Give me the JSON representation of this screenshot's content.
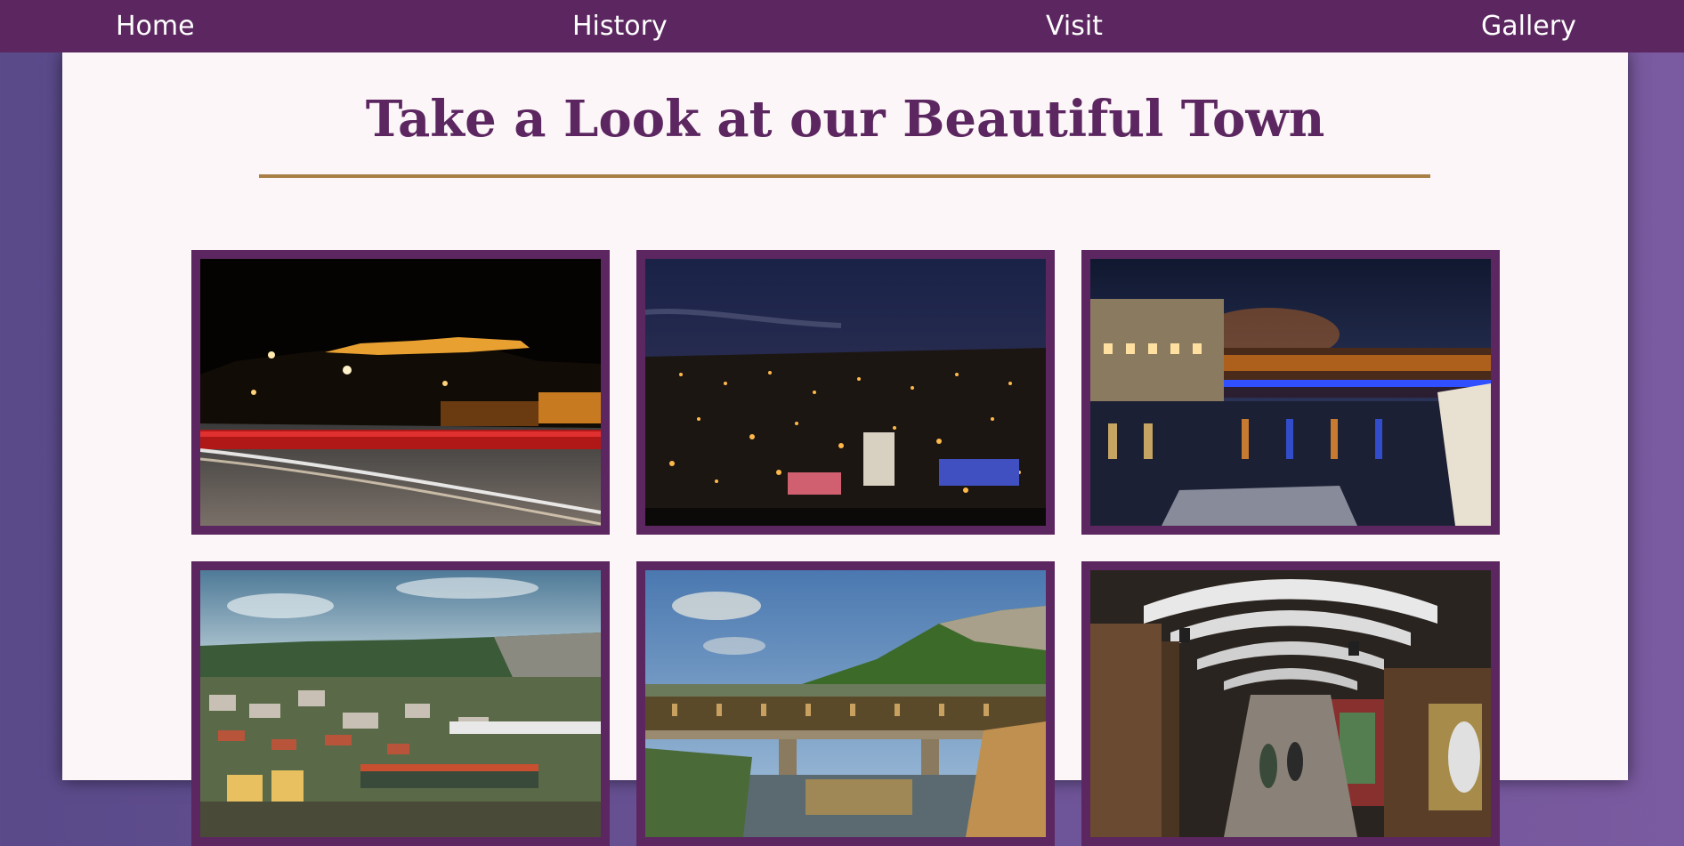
{
  "nav": {
    "items": [
      {
        "label": "Home"
      },
      {
        "label": "History"
      },
      {
        "label": "Visit"
      },
      {
        "label": "Gallery"
      }
    ]
  },
  "page": {
    "title": "Take a Look at our Beautiful Town"
  },
  "colors": {
    "nav_bg": "#5c2760",
    "accent_rule": "#a88046",
    "frame": "#5c2760",
    "page_bg": "#fdf6f8"
  },
  "gallery": {
    "photos": [
      {
        "icon": "photo-night-road-fortress"
      },
      {
        "icon": "photo-night-city-panorama"
      },
      {
        "icon": "photo-night-river-bridge"
      },
      {
        "icon": "photo-day-town-aerial"
      },
      {
        "icon": "photo-covered-bridge-river"
      },
      {
        "icon": "photo-covered-bridge-interior"
      }
    ]
  }
}
